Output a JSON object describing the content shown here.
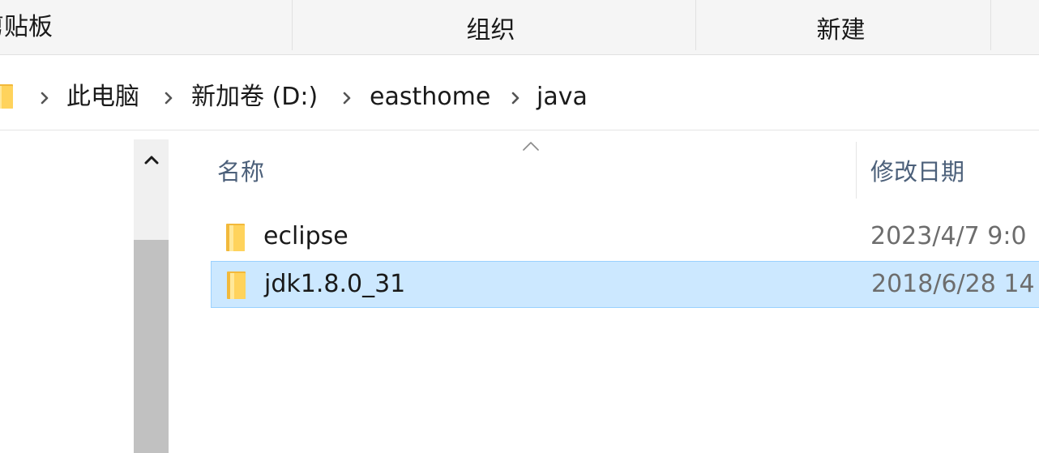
{
  "ribbon": {
    "groups": [
      {
        "label": "剪贴板"
      },
      {
        "label": "组织"
      },
      {
        "label": "新建"
      }
    ]
  },
  "address": {
    "icon": "folder-icon",
    "separator_icon": "chevron-right-icon",
    "crumbs": [
      "此电脑",
      "新加卷 (D:)",
      "easthome",
      "java"
    ]
  },
  "nav_pane": {
    "scroll_up_icon": "chevron-up-icon"
  },
  "file_list": {
    "columns": [
      {
        "label": "名称",
        "sort": "ascending",
        "sort_icon": "sort-ascending-icon"
      },
      {
        "label": "修改日期"
      }
    ],
    "rows": [
      {
        "icon": "folder-icon",
        "name": "eclipse",
        "modified": "2023/4/7 9:0",
        "selected": false
      },
      {
        "icon": "folder-icon",
        "name": "jdk1.8.0_31",
        "modified": "2018/6/28 14",
        "selected": true
      }
    ]
  },
  "colors": {
    "selection_bg": "#cce8ff",
    "selection_border": "#99d1ff",
    "folder": "#ffd35c",
    "header_text": "#4c607a",
    "date_text": "#6d6d6d"
  }
}
